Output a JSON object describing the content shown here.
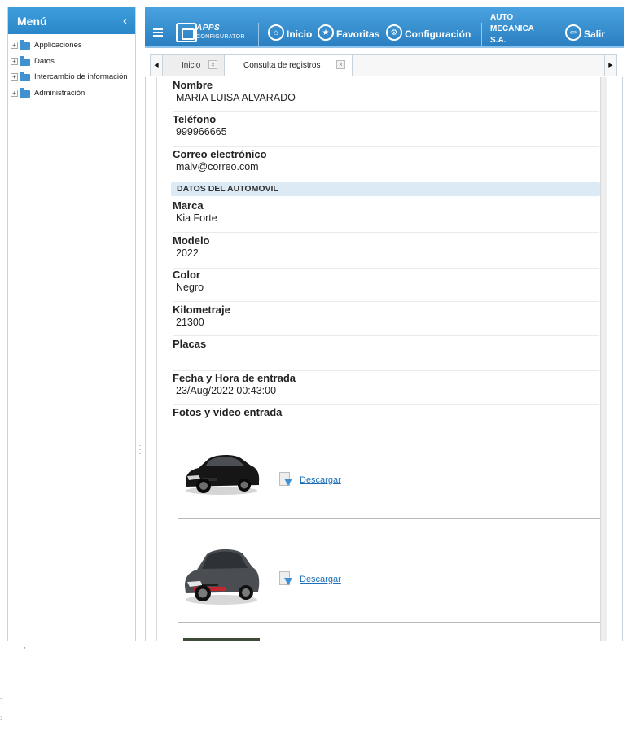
{
  "sidebar": {
    "title": "Menú",
    "collapse_icon": "‹",
    "items": [
      {
        "label": "Applicaciones",
        "expander": "+"
      },
      {
        "label": "Datos",
        "expander": "+"
      },
      {
        "label": "Intercambio de información",
        "expander": "+"
      },
      {
        "label": "Administración",
        "expander": "+"
      }
    ]
  },
  "topbar": {
    "logo": {
      "top": "APPS",
      "bottom": "CONFIGURATOR"
    },
    "nav": {
      "inicio": "Inicio",
      "favoritas": "Favoritas",
      "configuracion": "Configuración",
      "salir": "Salir"
    },
    "company": "AUTO MECÁNICA S.A."
  },
  "tabs": {
    "items": [
      {
        "label": "Inicio",
        "active": false
      },
      {
        "label": "Consulta de registros",
        "active": true
      }
    ],
    "close_glyph": "×"
  },
  "record": {
    "fields": [
      {
        "label": "Nombre",
        "value": "MARIA LUISA ALVARADO"
      },
      {
        "label": "Teléfono",
        "value": "999966665"
      },
      {
        "label": "Correo electrónico",
        "value": "malv@correo.com"
      }
    ],
    "section_title": "DATOS DEL AUTOMOVIL",
    "car_fields": [
      {
        "label": "Marca",
        "value": "Kia Forte"
      },
      {
        "label": "Modelo",
        "value": "2022"
      },
      {
        "label": "Color",
        "value": "Negro"
      },
      {
        "label": "Kilometraje",
        "value": "21300"
      },
      {
        "label": "Placas",
        "value": ""
      },
      {
        "label": "Fecha y Hora de entrada",
        "value": "23/Aug/2022 00:43:00"
      }
    ],
    "media_label": "Fotos y video entrada",
    "media": [
      {
        "download_label": "Descargar"
      },
      {
        "download_label": "Descargar"
      }
    ]
  },
  "colors": {
    "header_blue": "#2a86c8",
    "section_bg": "#dceaf5",
    "link": "#1e6fb8"
  }
}
